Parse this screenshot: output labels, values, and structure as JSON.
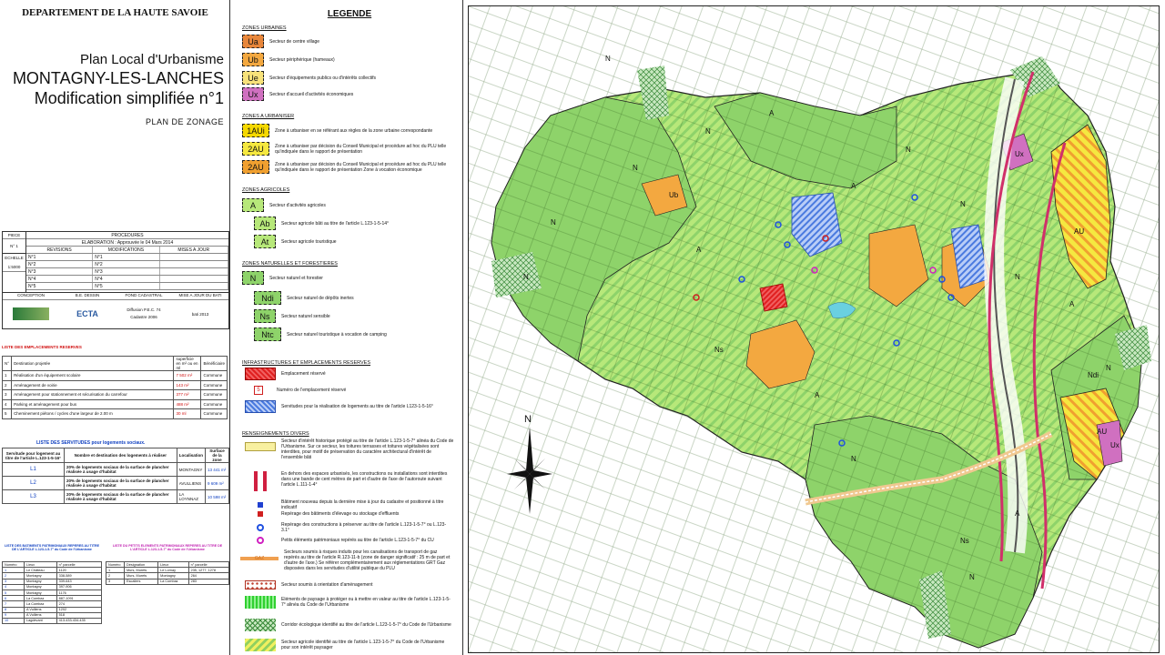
{
  "header": {
    "department": "DEPARTEMENT DE LA HAUTE SAVOIE",
    "title_line1": "Plan Local d'Urbanisme",
    "title_line2": "MONTAGNY-LES-LANCHES",
    "title_line3": "Modification simplifiée n°1",
    "title_line4": "PLAN DE ZONAGE"
  },
  "procedures": {
    "piece_label": "PIECE",
    "piece_value": "N° 1",
    "title": "PROCEDURES",
    "elaboration": "ELABORATION : Approuvée le 04 Mars 2014",
    "columns": [
      "REVISIONS",
      "MODIFICATIONS",
      "MISES A JOUR"
    ],
    "echelle_label": "ECHELLE",
    "echelle_value": "1:5000",
    "rows": [
      "N°1",
      "N°2",
      "N°3",
      "N°4",
      "N°5"
    ],
    "approved": "Approuvée le :",
    "conception": "CONCEPTION",
    "be_dessin": "B.E. DESSIN",
    "fond": "FOND CADASTRAL",
    "maj": "MISE A JOUR DU BATI",
    "company": "ECTA",
    "diffusion": "Diffusion P.E.C. 74",
    "cadastre": "Cadastre 2006",
    "bati": "bati 2013"
  },
  "reserves": {
    "title": "LISTE DES EMPLACEMENTS RESERVES",
    "headers": [
      "N°",
      "Destination projetée",
      "superficie en m² ou en ml",
      "Bénéficiaire"
    ],
    "rows": [
      [
        "1",
        "Réalisation d'un équipement scolaire",
        "7 502 m²",
        "Commune"
      ],
      [
        "2",
        "Aménagement de voirie",
        "143 m²",
        "Commune"
      ],
      [
        "3",
        "Aménagement pour stationnement et sécurisation du carrefour",
        "377 m²",
        "Commune"
      ],
      [
        "4",
        "Parking et aménagement pour bus",
        "488 m²",
        "Commune"
      ],
      [
        "5",
        "Cheminement piétons / cycles d'une largeur de 2.00 m",
        "30 ml",
        "Commune"
      ]
    ]
  },
  "servitudes": {
    "title": "LISTE DES SERVITUDES pour logements sociaux.",
    "headers": [
      "Servitude pour logement au titre de l'article L.123-1-5-16°",
      "Nombre et destination des logements à réaliser",
      "Localisation",
      "Surface de la zone"
    ],
    "rows": [
      [
        "L1",
        "20% de logements sociaux de la surface de plancher réalisée à usage d'habitat",
        "MONTAGNY",
        "13 441 m²"
      ],
      [
        "L2",
        "20% de logements sociaux de la surface de plancher réalisée à usage d'habitat",
        "AVULLIENS",
        "9 609 m²"
      ],
      [
        "L3",
        "20% de logements sociaux de la surface de plancher réalisée à usage d'habitat",
        "LA LOYNNAZ",
        "10 598 m²"
      ]
    ]
  },
  "batiments": {
    "title": "LISTE DES BATIMENTS PATRIMONIAUX REPERES AU TITRE DE L'ARTICLE L.123-1-5-7° du Code de l'Urbanisme",
    "headers": [
      "Numéro",
      "Lieux",
      "n° parcelle"
    ],
    "rows": [
      [
        "1",
        "Le Château",
        "1120"
      ],
      [
        "2",
        "Montagny",
        "338-589"
      ],
      [
        "3",
        "Montagny",
        "339-643"
      ],
      [
        "4",
        "Montagny",
        "397-906"
      ],
      [
        "5",
        "Montagny",
        "1176"
      ],
      [
        "6",
        "La Combaz",
        "887-1091"
      ],
      [
        "7",
        "La Combaz",
        "274"
      ],
      [
        "8",
        "A Vulliens",
        "1202"
      ],
      [
        "9",
        "A Vulliens",
        "518"
      ],
      [
        "10",
        "Lagdevant",
        "413-433-434-435"
      ]
    ]
  },
  "petits": {
    "title": "LISTE DU PETITS ELEMENTS PATRIMONIAUX REPERES AU TITRE DE L'ARTICLE L.123-1-5-7° du Code de l'Urbanisme",
    "headers": [
      "Numéro",
      "Désignation",
      "Lieux",
      "n° parcelle"
    ],
    "rows": [
      [
        "1",
        "Murs, Murets",
        "Le Lornay",
        "235, 1277, 1278"
      ],
      [
        "2",
        "Murs, Murets",
        "Montagny",
        "264"
      ],
      [
        "3",
        "Escaliers",
        "La Combaz",
        "283"
      ]
    ]
  },
  "legend": {
    "title": "LEGENDE",
    "sections": {
      "urbaines": "ZONES URBAINES",
      "urbaniser": "ZONES A URBANISER",
      "agricoles": "ZONES AGRICOLES",
      "naturelles": "ZONES NATURELLES ET FORESTIERES",
      "infra": "INFRASTRUCTURES ET EMPLACEMENTS RESERVES",
      "divers": "RENSEIGNEMENTS DIVERS"
    },
    "zones": [
      {
        "code": "Ua",
        "label": "Secteur de centre village",
        "color": "#e8863a"
      },
      {
        "code": "Ub",
        "label": "Secteur périphérique (hameaux)",
        "color": "#f3a840"
      },
      {
        "code": "Ue",
        "label": "Secteur d'équipements publics ou d'intérêts collectifs",
        "color": "#f7e27a"
      },
      {
        "code": "Ux",
        "label": "Secteur d'accueil d'activités économiques",
        "color": "#d070c0"
      },
      {
        "code": "1AUi",
        "label": "Zone à urbaniser en se référant aux règles de la zone urbaine correspondante",
        "color": "#f5d800"
      },
      {
        "code": "2AU",
        "label": "Zone à urbaniser par décision du Conseil Municipal et procédure ad hoc du PLU telle qu'indiquée dans le rapport de présentation",
        "color": "#f5e840"
      },
      {
        "code": "2AU",
        "label": "Zone à urbaniser par décision du Conseil Municipal et procédure ad hoc du PLU telle qu'indiquée dans le rapport de présentation Zone à vocation économique",
        "color": "#f0a030"
      },
      {
        "code": "A",
        "label": "Secteur d'activités agricoles",
        "color": "#b7e87a"
      },
      {
        "code": "Ab",
        "label": "Secteur agricole bâti au titre de l'article L.123-1-5-14°",
        "color": "#b7e87a"
      },
      {
        "code": "At",
        "label": "Secteur agricole touristique",
        "color": "#b7e87a"
      },
      {
        "code": "N",
        "label": "Secteur naturel et forestier",
        "color": "#8ed36a"
      },
      {
        "code": "Ndi",
        "label": "Secteur naturel de dépôts inertes",
        "color": "#8ed36a"
      },
      {
        "code": "Ns",
        "label": "Secteur naturel sensible",
        "color": "#8ed36a"
      },
      {
        "code": "Ntc",
        "label": "Secteur naturel touristique à vocation de camping",
        "color": "#8ed36a"
      }
    ],
    "infra": [
      "Emplacement réservé",
      "Numéro de l'emplacement réservé",
      "Servitudes pour la réalisation de logements au titre de l'article L123-1-5-16°"
    ],
    "divers": [
      "Secteur d'intérêt historique protégé au titre de l'article L.123-1-5-7° alinéa du Code de l'Urbanisme. Sur ce secteur, les toitures terrasses et toitures végétalisées sont interdites, pour motif de préservation du caractère architectural d'intérêt de l'ensemble bâti",
      "En dehors des espaces urbanisés, les constructions ou installations sont interdites dans une bande de cent mètres de part et d'autre de l'axe de l'autoroute suivant l'article L.111-1-4°",
      "Bâtiment nouveau depuis la dernière mise à jour du cadastre et positionné à titre indicatif",
      "Repérage des bâtiments d'élevage ou stockage d'effluents",
      "Repérage des constructions à préserver au titre de l'article L.123-1-5-7° ou L.123-3.1°",
      "Petits éléments patrimoniaux repérés au titre de l'article L.123-1-5-7° du CU",
      "Secteurs soumis à risques induits pour les canalisations de transport de gaz repérés au titre de l'article R.123-11-b (zone de danger significatif : 25 m de part et d'autre de l'axe.) Se référer complémentairement aux réglementations GRT Gaz disposées dans les servitudes d'utilité publique du PLU",
      "Secteur soumis à orientation d'aménagement",
      "Eléments de paysage à protéger ou à mettre en valeur au titre de l'article L.123-1-5-7° alinéa du Code de l'Urbanisme",
      "Corridor écologique identifié au titre de l'article L.123-1-5-7° du Code de l'Urbanisme",
      "Secteur agricole identifié au titre de l'article L.123-1-5-7° du Code de l'Urbanisme pour son intérêt paysager"
    ],
    "gaz_label": "GAZ",
    "er_number": "5"
  },
  "map": {
    "north_label": "N",
    "zone_labels": [
      "N",
      "N",
      "N",
      "N",
      "N",
      "N",
      "N",
      "N",
      "N",
      "N",
      "N",
      "A",
      "A",
      "A",
      "A",
      "A",
      "A",
      "Ns",
      "Ns",
      "Ndi",
      "Ub",
      "AU",
      "AU",
      "Ux",
      "Ux"
    ]
  },
  "colors": {
    "agri": "#b7e87a",
    "nat": "#8ed36a",
    "urb": "#f3a840",
    "road": "#d0306a",
    "water": "#3a6fd8"
  }
}
